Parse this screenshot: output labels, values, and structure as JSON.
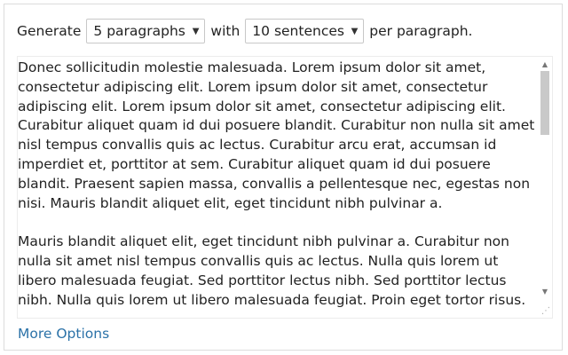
{
  "controls": {
    "label_generate": "Generate",
    "paragraphs_selected": "5 paragraphs",
    "label_with": "with",
    "sentences_selected": "10 sentences",
    "label_per": "per paragraph."
  },
  "text": {
    "paragraphs": [
      "Donec sollicitudin molestie malesuada. Lorem ipsum dolor sit amet, consectetur adipiscing elit. Lorem ipsum dolor sit amet, consectetur adipiscing elit. Lorem ipsum dolor sit amet, consectetur adipiscing elit. Curabitur aliquet quam id dui posuere blandit. Curabitur non nulla sit amet nisl tempus convallis quis ac lectus. Curabitur arcu erat, accumsan id imperdiet et, porttitor at sem. Curabitur aliquet quam id dui posuere blandit. Praesent sapien massa, convallis a pellentesque nec, egestas non nisi. Mauris blandit aliquet elit, eget tincidunt nibh pulvinar a.",
      "Mauris blandit aliquet elit, eget tincidunt nibh pulvinar a. Curabitur non nulla sit amet nisl tempus convallis quis ac lectus. Nulla quis lorem ut libero malesuada feugiat. Sed porttitor lectus nibh. Sed porttitor lectus nibh. Nulla quis lorem ut libero malesuada feugiat. Proin eget tortor risus."
    ]
  },
  "footer": {
    "more_options": "More Options"
  },
  "icons": {
    "dropdown": "chevron-down-icon",
    "scroll_up": "scroll-up-arrow-icon",
    "scroll_down": "scroll-down-arrow-icon",
    "resize": "resize-grip-icon"
  },
  "colors": {
    "link": "#2b72a8",
    "border": "#dcdcdc",
    "thumb": "#c9c9c9"
  }
}
